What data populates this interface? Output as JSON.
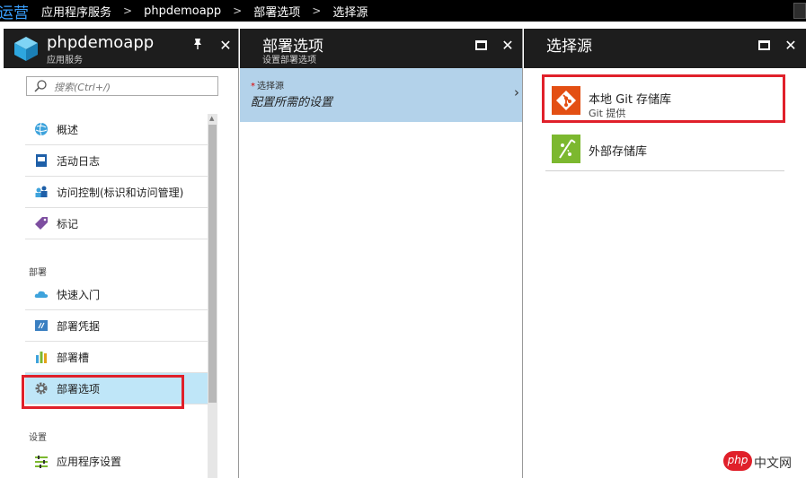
{
  "topbar": {
    "brand": "运营",
    "crumbs": [
      "应用程序服务",
      "phpdemoapp",
      "部署选项",
      "选择源"
    ],
    "separator": ">"
  },
  "blade1": {
    "title": "phpdemoapp",
    "subtitle": "应用服务",
    "pin_icon": "pin-icon",
    "close_icon": "✕",
    "search_placeholder": "搜索(Ctrl+/)",
    "items": [
      {
        "label": "概述",
        "icon": "globe-icon"
      },
      {
        "label": "活动日志",
        "icon": "log-icon"
      },
      {
        "label": "访问控制(标识和访问管理)",
        "icon": "users-icon"
      },
      {
        "label": "标记",
        "icon": "tag-icon"
      },
      {
        "label": "快速入门",
        "icon": "cloud-icon"
      },
      {
        "label": "部署凭据",
        "icon": "credentials-icon"
      },
      {
        "label": "部署槽",
        "icon": "slots-icon"
      },
      {
        "label": "部署选项",
        "icon": "gear-icon"
      },
      {
        "label": "应用程序设置",
        "icon": "settings-list-icon"
      }
    ],
    "sections": [
      "部署",
      "设置"
    ]
  },
  "blade2": {
    "title": "部署选项",
    "subtitle": "设置部署选项",
    "close_icon": "✕",
    "field_label": "选择源",
    "required_marker": "*",
    "field_value": "配置所需的设置",
    "chevron": "›"
  },
  "blade3": {
    "title": "选择源",
    "close_icon": "✕",
    "sources": [
      {
        "name": "本地 Git 存储库",
        "desc": "Git 提供",
        "icon": "git-icon",
        "color": "#e34f13"
      },
      {
        "name": "外部存储库",
        "desc": "",
        "icon": "external-repo-icon",
        "color": "#7cb82f"
      }
    ]
  },
  "watermark": {
    "php": "php",
    "text": "中文网"
  },
  "colors": {
    "highlight": "#e0202a",
    "selected_bg": "#bfe6f8",
    "field_bg": "#b3d2ea",
    "header_bg": "#1d1d1d"
  }
}
